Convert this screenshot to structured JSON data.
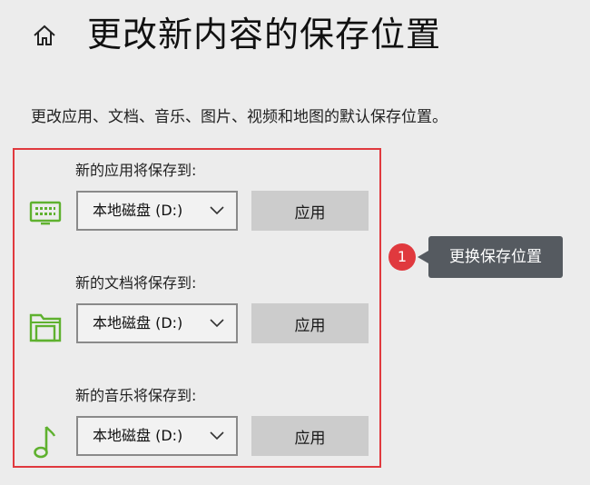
{
  "header": {
    "home_icon": "home-icon",
    "title": "更改新内容的保存位置"
  },
  "description": "更改应用、文档、音乐、图片、视频和地图的默认保存位置。",
  "settings": {
    "apps": {
      "label": "新的应用将保存到:",
      "icon": "monitor-icon",
      "selected_drive": "本地磁盘 (D:)",
      "button_label": "应用"
    },
    "documents": {
      "label": "新的文档将保存到:",
      "icon": "folder-icon",
      "selected_drive": "本地磁盘 (D:)",
      "button_label": "应用"
    },
    "music": {
      "label": "新的音乐将保存到:",
      "icon": "music-note-icon",
      "selected_drive": "本地磁盘 (D:)",
      "button_label": "应用"
    }
  },
  "callout": {
    "number": "1",
    "text": "更换保存位置"
  },
  "colors": {
    "accent_green": "#5fb12f",
    "highlight_red": "#e0393e",
    "callout_bg": "#555a60",
    "button_bg": "#cccccc",
    "page_bg": "#ececec"
  }
}
